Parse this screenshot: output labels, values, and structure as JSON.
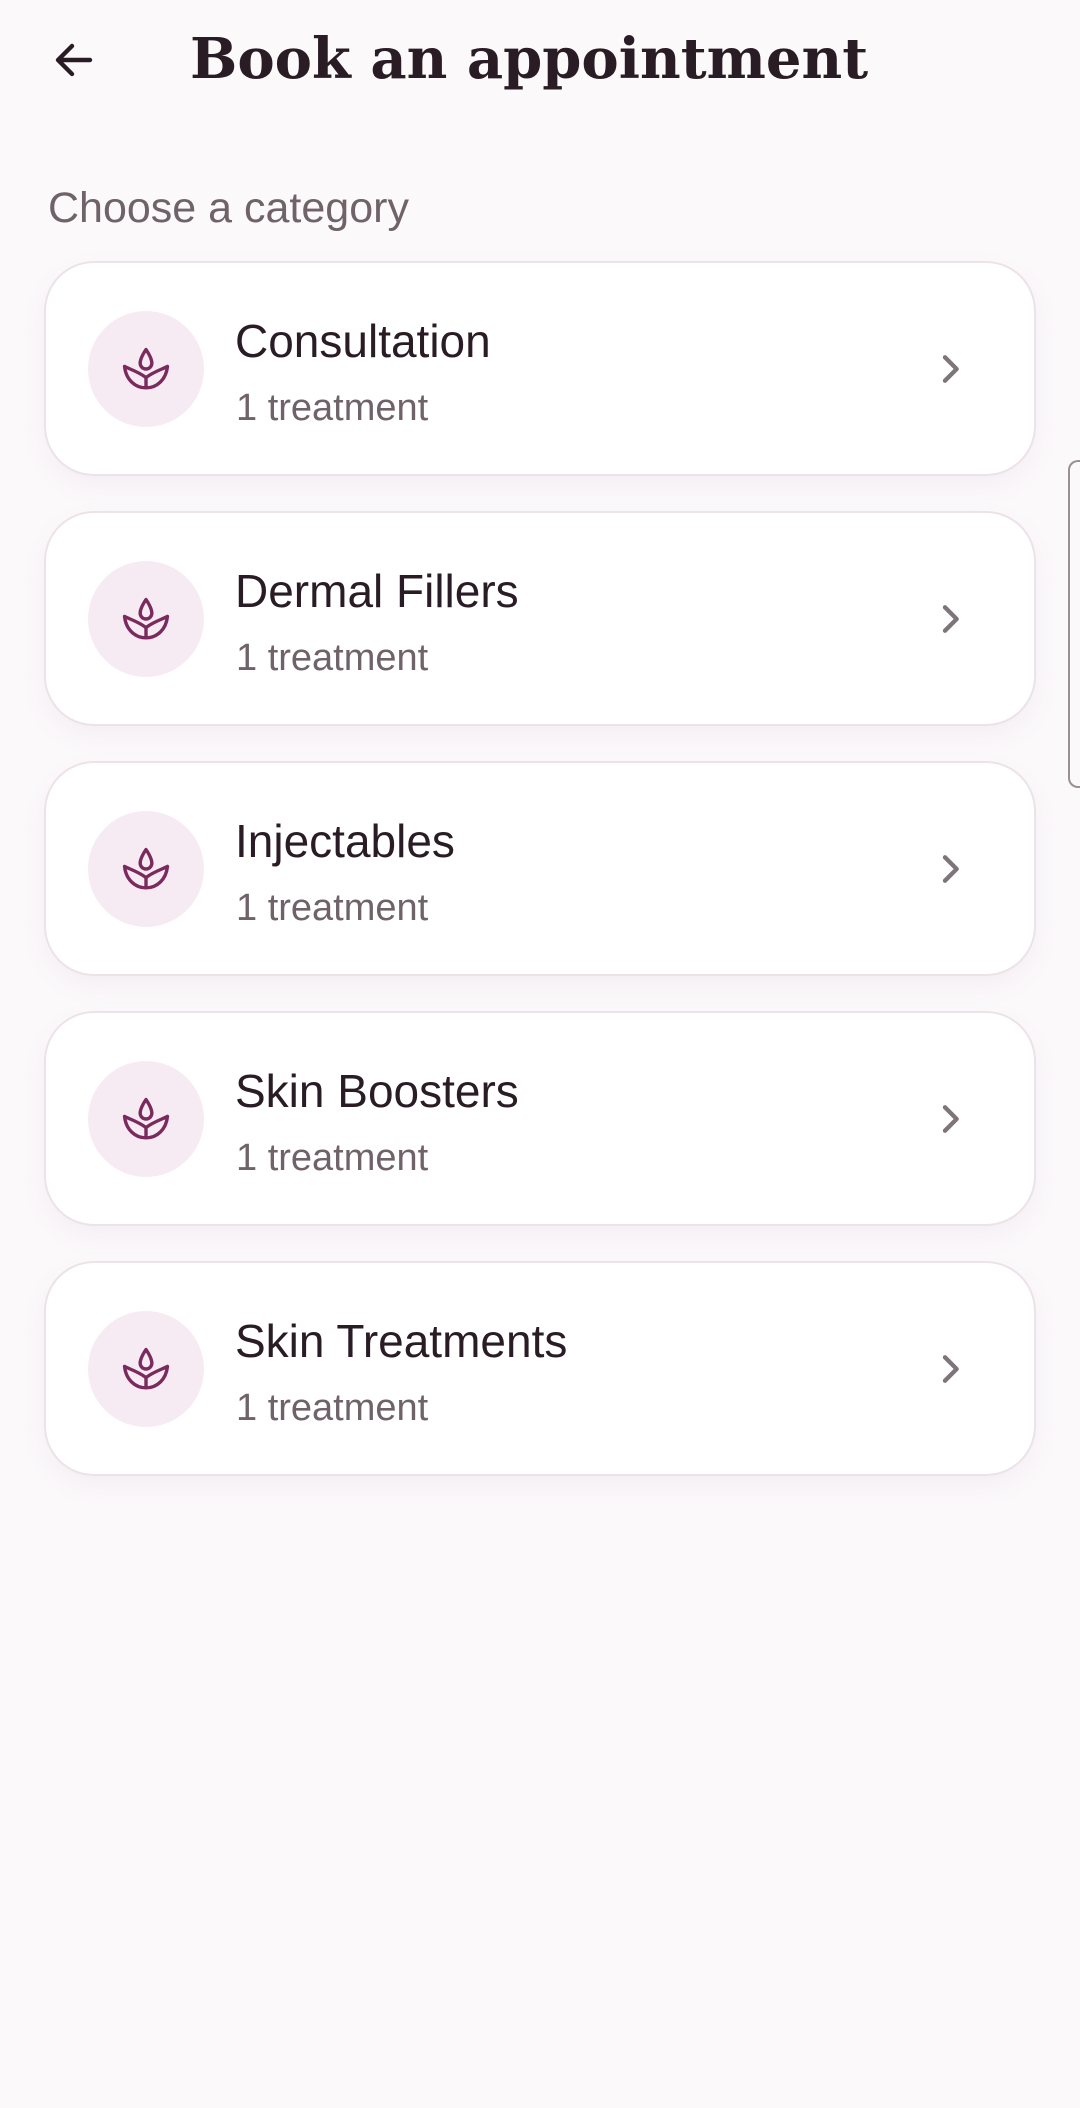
{
  "header": {
    "title": "Book an appointment",
    "back_icon": "arrow-left-icon"
  },
  "section_label": "Choose a category",
  "categories": [
    {
      "name": "Consultation",
      "count": "1 treatment",
      "icon": "lotus-icon"
    },
    {
      "name": "Dermal Fillers",
      "count": "1 treatment",
      "icon": "lotus-icon"
    },
    {
      "name": "Injectables",
      "count": "1 treatment",
      "icon": "lotus-icon"
    },
    {
      "name": "Skin Boosters",
      "count": "1 treatment",
      "icon": "lotus-icon"
    },
    {
      "name": "Skin Treatments",
      "count": "1 treatment",
      "icon": "lotus-icon"
    }
  ],
  "colors": {
    "accent": "#7a2a5c",
    "icon_background": "#f7ebf3",
    "page_background": "#fcf9fb",
    "card_background": "#ffffff",
    "text_primary": "#2a1c24",
    "text_secondary": "#6f6369"
  }
}
